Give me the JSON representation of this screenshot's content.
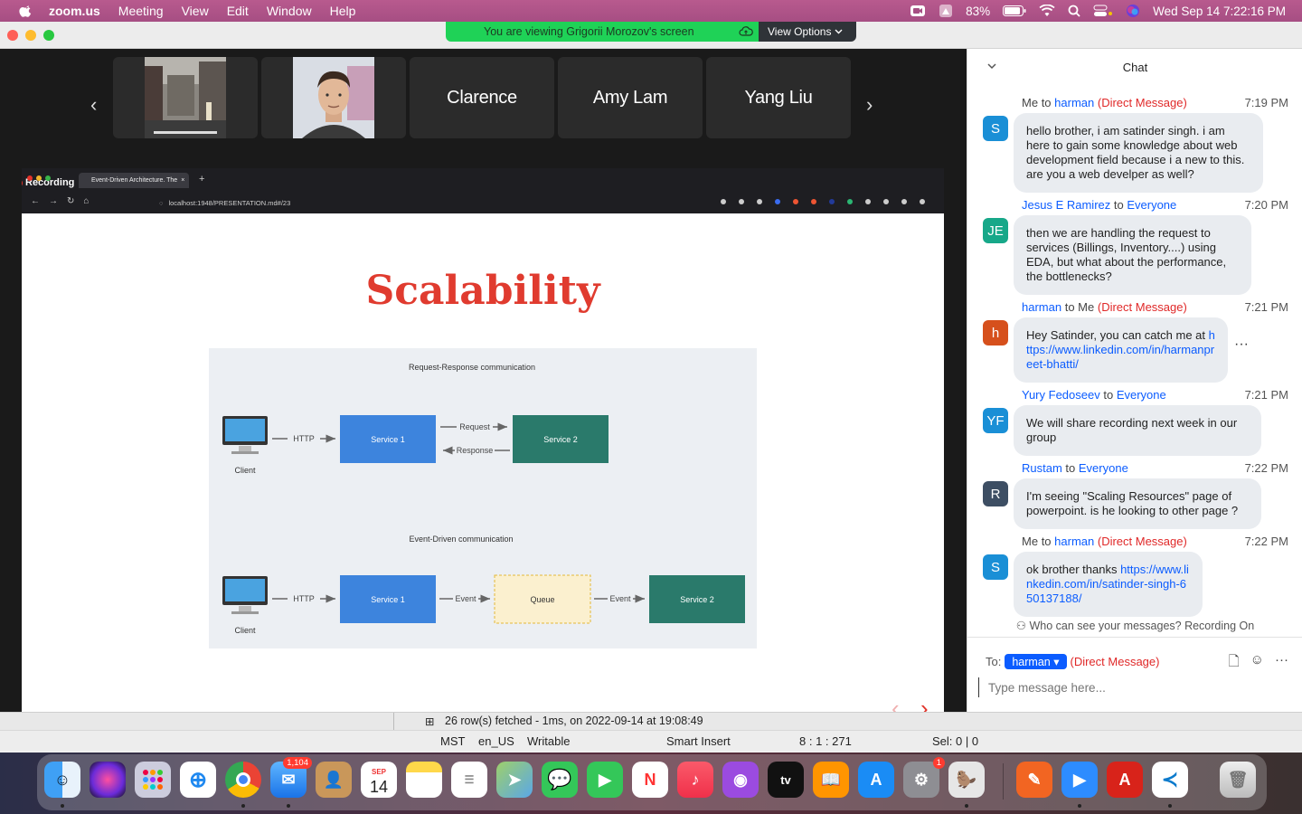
{
  "menubar": {
    "app": "zoom.us",
    "items": [
      "Meeting",
      "View",
      "Edit",
      "Window",
      "Help"
    ],
    "battery": "83%",
    "clock": "Wed Sep 14  7:22:16 PM"
  },
  "banner": {
    "viewing": "You are viewing Grigorii Morozov's screen",
    "view_options": "View Options"
  },
  "participants": [
    "Clarence",
    "Amy Lam",
    "Yang Liu"
  ],
  "share": {
    "recording_label": "Recording",
    "tab_title": "Event-Driven Architecture. The",
    "url": "localhost:1948/PRESENTATION.md#/23",
    "slide_title": "Scalability",
    "diagram": {
      "top_title": "Request-Response communication",
      "bottom_title": "Event-Driven communication",
      "client": "Client",
      "http": "HTTP",
      "service1": "Service 1",
      "service2": "Service 2",
      "request": "Request",
      "response": "Response",
      "event": "Event",
      "queue": "Queue"
    }
  },
  "status": {
    "fetched": "26 row(s) fetched - 1ms, on 2022-09-14 at 19:08:49",
    "tz": "MST",
    "locale": "en_US",
    "mode": "Writable",
    "insert": "Smart Insert",
    "pos": "8 : 1 : 271",
    "sel": "Sel: 0 | 0"
  },
  "chat": {
    "title": "Chat",
    "messages": [
      {
        "from": "Me",
        "to": "harman",
        "dm": "(Direct Message)",
        "time": "7:19 PM",
        "avatar": "S",
        "color": "#1a8fd6",
        "text": "hello brother, i am satinder singh. i am here to gain some knowledge about web development field because i a new to this. are you a web develper as well?"
      },
      {
        "from": "Jesus E Ramirez",
        "to": "Everyone",
        "dm": "",
        "time": "7:20 PM",
        "avatar": "JE",
        "color": "#17a889",
        "text": "then we are handling the request to services (Billings, Inventory....) using EDA, but what about the performance, the bottlenecks?"
      },
      {
        "from": "harman",
        "to": "Me",
        "dm": "(Direct Message)",
        "time": "7:21 PM",
        "avatar": "h",
        "color": "#d6501c",
        "text": "Hey Satinder, you can catch me at ",
        "link": "https://www.linkedin.com/in/harmanpreet-bhatti/"
      },
      {
        "from": "Yury Fedoseev",
        "to": "Everyone",
        "dm": "",
        "time": "7:21 PM",
        "avatar": "YF",
        "color": "#1a8fd6",
        "text": "We will share recording next week in our group"
      },
      {
        "from": "Rustam",
        "to": "Everyone",
        "dm": "",
        "time": "7:22 PM",
        "avatar": "R",
        "color": "#3d4e63",
        "text": "I'm seeing \"Scaling Resources\" page of powerpoint. is he looking to other page ?"
      },
      {
        "from": "Me",
        "to": "harman",
        "dm": "(Direct Message)",
        "time": "7:22 PM",
        "avatar": "S",
        "color": "#1a8fd6",
        "text": "ok brother thanks ",
        "link": "https://www.linkedin.com/in/satinder-singh-650137188/"
      }
    ],
    "to_word": "to",
    "who_can_see": "Who can see your messages? Recording On",
    "to_label": "To:",
    "to_target": "harman",
    "to_dm": "(Direct Message)",
    "input_placeholder": "Type message here..."
  },
  "dock": {
    "mail_badge": "1,104",
    "cal_month": "SEP",
    "cal_day": "14",
    "settings_badge": "1"
  }
}
